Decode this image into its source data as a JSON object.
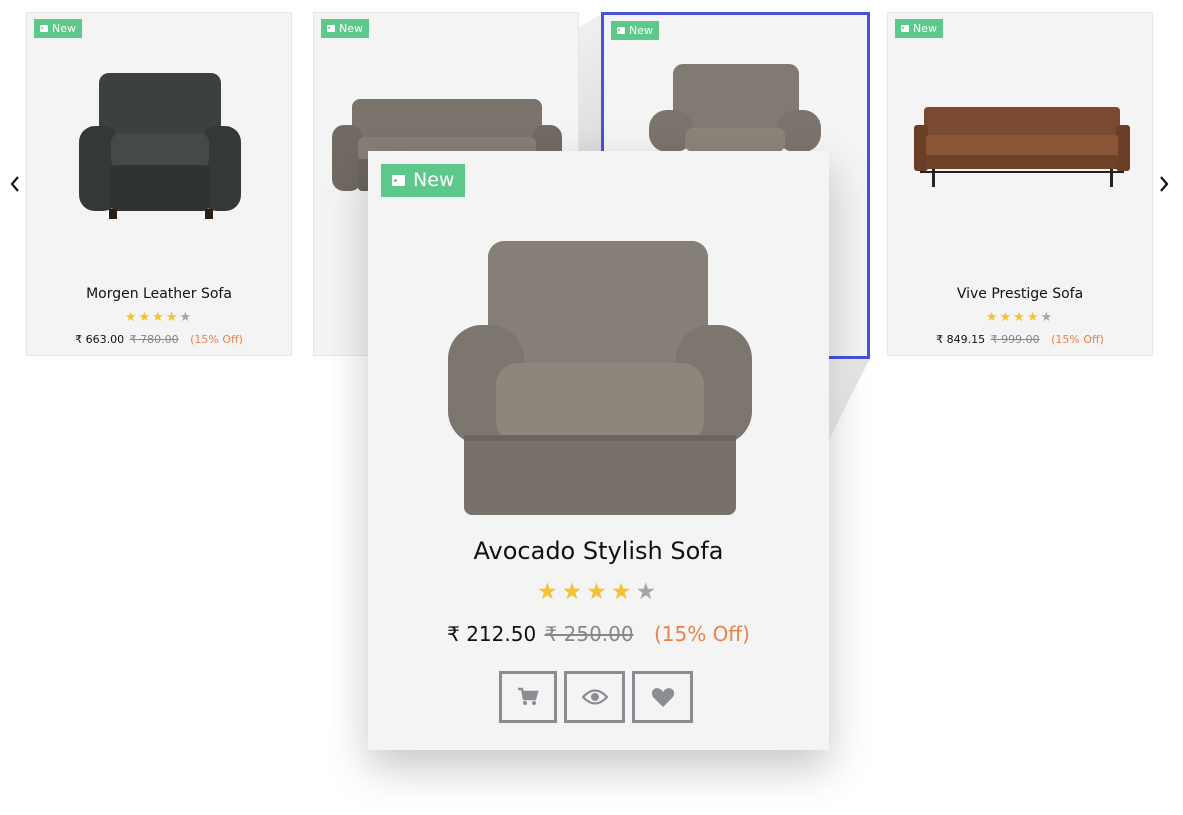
{
  "carousel": {
    "prev_icon": "chevron-left-icon",
    "next_icon": "chevron-right-icon",
    "products": [
      {
        "badge": "New",
        "name": "Morgen Leather Sofa",
        "price": "₹ 663.00",
        "old_price": "₹ 780.00",
        "discount": "(15% Off)",
        "rating": 4,
        "max_rating": 5
      },
      {
        "badge": "New",
        "name": "",
        "price": "",
        "old_price": "",
        "discount": "",
        "rating": 0,
        "max_rating": 5
      },
      {
        "badge": "New",
        "name": "",
        "price": "",
        "old_price": "",
        "discount": "",
        "rating": 0,
        "max_rating": 5,
        "selected": true
      },
      {
        "badge": "New",
        "name": "Vive Prestige Sofa",
        "price": "₹ 849.15",
        "old_price": "₹ 999.00",
        "discount": "(15% Off)",
        "rating": 4,
        "max_rating": 5
      }
    ]
  },
  "quickview": {
    "badge": "New",
    "name": "Avocado Stylish Sofa",
    "price": "₹ 212.50",
    "old_price": "₹ 250.00",
    "discount": "(15% Off)",
    "rating": 4,
    "max_rating": 5,
    "actions": [
      {
        "icon": "cart-icon"
      },
      {
        "icon": "eye-icon"
      },
      {
        "icon": "heart-icon"
      }
    ]
  },
  "colors": {
    "badge": "#5cc98a",
    "selected_border": "#4a53d8",
    "discount": "#e8834a",
    "star": "#f1c232",
    "star_off": "#a6a6a6"
  }
}
